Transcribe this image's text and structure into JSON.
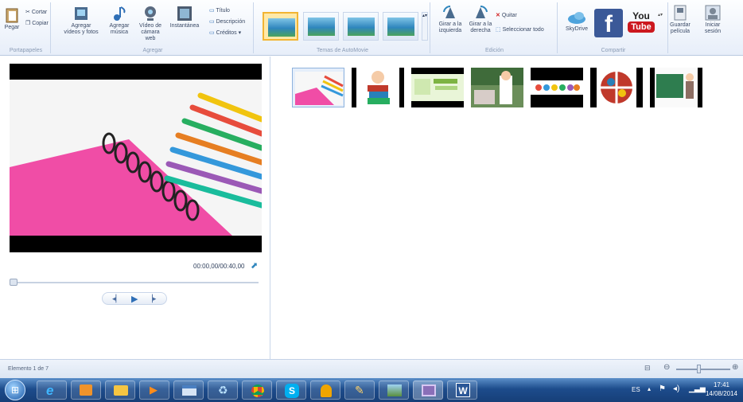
{
  "ribbon": {
    "clipboard": {
      "paste": "Pegar",
      "cut": "Cortar",
      "copy": "Copiar",
      "group": "Portapapeles"
    },
    "add": {
      "videos_photos": "Agregar vídeos y fotos",
      "music": "Agregar música",
      "webcam": "Vídeo de cámara web",
      "snapshot": "Instantánea",
      "title": "Título",
      "caption": "Descripción",
      "credits": "Créditos",
      "group": "Agregar"
    },
    "themes": {
      "group": "Temas de AutoMovie"
    },
    "edit": {
      "rotate_left": "Girar a la izquierda",
      "rotate_right": "Girar a la derecha",
      "remove": "Quitar",
      "select_all": "Seleccionar todo",
      "group": "Edición"
    },
    "share": {
      "skydrive": "SkyDrive",
      "facebook": "f",
      "youtube_you": "You",
      "youtube_tube": "Tube",
      "save_movie": "Guardar película",
      "signin": "Iniciar sesión",
      "group": "Compartir"
    }
  },
  "preview": {
    "timecode": "00:00,00/00:40,00"
  },
  "status": {
    "text": "Elemento 1 de 7"
  },
  "taskbar": {
    "lang": "ES",
    "time": "17:41",
    "date": "14/08/2014"
  },
  "colors": {
    "accent": "#f2b533",
    "taskbar": "#1d4c8c",
    "facebook": "#3b5998",
    "youtube": "#cc181e"
  }
}
